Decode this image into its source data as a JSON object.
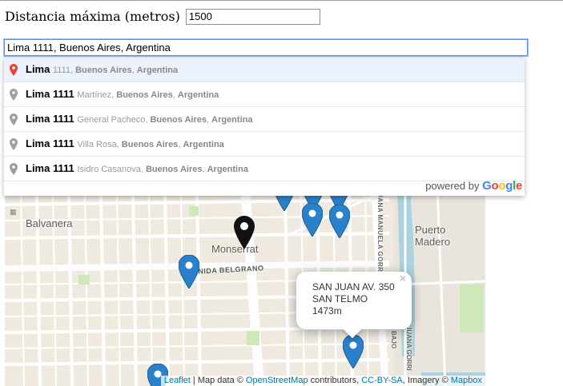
{
  "form": {
    "distance_label": "Distancia máxima (metros)",
    "distance_value": "1500",
    "address_value": "Lima 1111, Buenos Aires, Argentina"
  },
  "autocomplete": {
    "suggestions": [
      {
        "main": "Lima",
        "secondary_parts": [
          "1111, ",
          "Buenos Aires",
          ", ",
          "Argentina"
        ],
        "active": true
      },
      {
        "main": "Lima 1111",
        "secondary_parts": [
          "Martínez, ",
          "Buenos Aires",
          ", ",
          "Argentina"
        ],
        "active": false
      },
      {
        "main": "Lima 1111",
        "secondary_parts": [
          "General Pacheco, ",
          "Buenos Aires",
          ", ",
          "Argentina"
        ],
        "active": false
      },
      {
        "main": "Lima 1111",
        "secondary_parts": [
          "Villa Rosa, ",
          "Buenos Aires",
          ", ",
          "Argentina"
        ],
        "active": false
      },
      {
        "main": "Lima 1111",
        "secondary_parts": [
          "Isidro Casanova, ",
          "Buenos Aires",
          ", ",
          "Argentina"
        ],
        "active": false
      }
    ],
    "powered_by": "powered by",
    "google": [
      "G",
      "o",
      "o",
      "g",
      "l",
      "e"
    ],
    "google_colors": [
      "#4285F4",
      "#EA4335",
      "#FBBC05",
      "#4285F4",
      "#34A853",
      "#EA4335"
    ]
  },
  "map": {
    "labels": {
      "balvanera": "Balvanera",
      "monserrat": "Monserrat",
      "puerto_madero": "Puerto Madero",
      "av_belgrano": "AVENIDA BELGRANO",
      "juana_manuela": "JUANA MANUELA GORRITI",
      "bajo": "BAJO",
      "gorriti": "JUANA GORRI"
    },
    "popup": {
      "line1": "SAN JUAN AV. 350",
      "line2": "SAN TELMO",
      "line3": "1473m",
      "close": "×"
    },
    "attribution": {
      "leaflet": "Leaflet",
      "sep": " | Map data © ",
      "osm": "OpenStreetMap",
      "contrib": " contributors, ",
      "ccbysa": "CC-BY-SA",
      "imagery": ", Imagery © ",
      "mapbox": "Mapbox"
    },
    "colors": {
      "pin_blue": "#2a81cb",
      "pin_black": "#111111",
      "water": "#aad3df",
      "park": "#cfe8b9"
    }
  }
}
